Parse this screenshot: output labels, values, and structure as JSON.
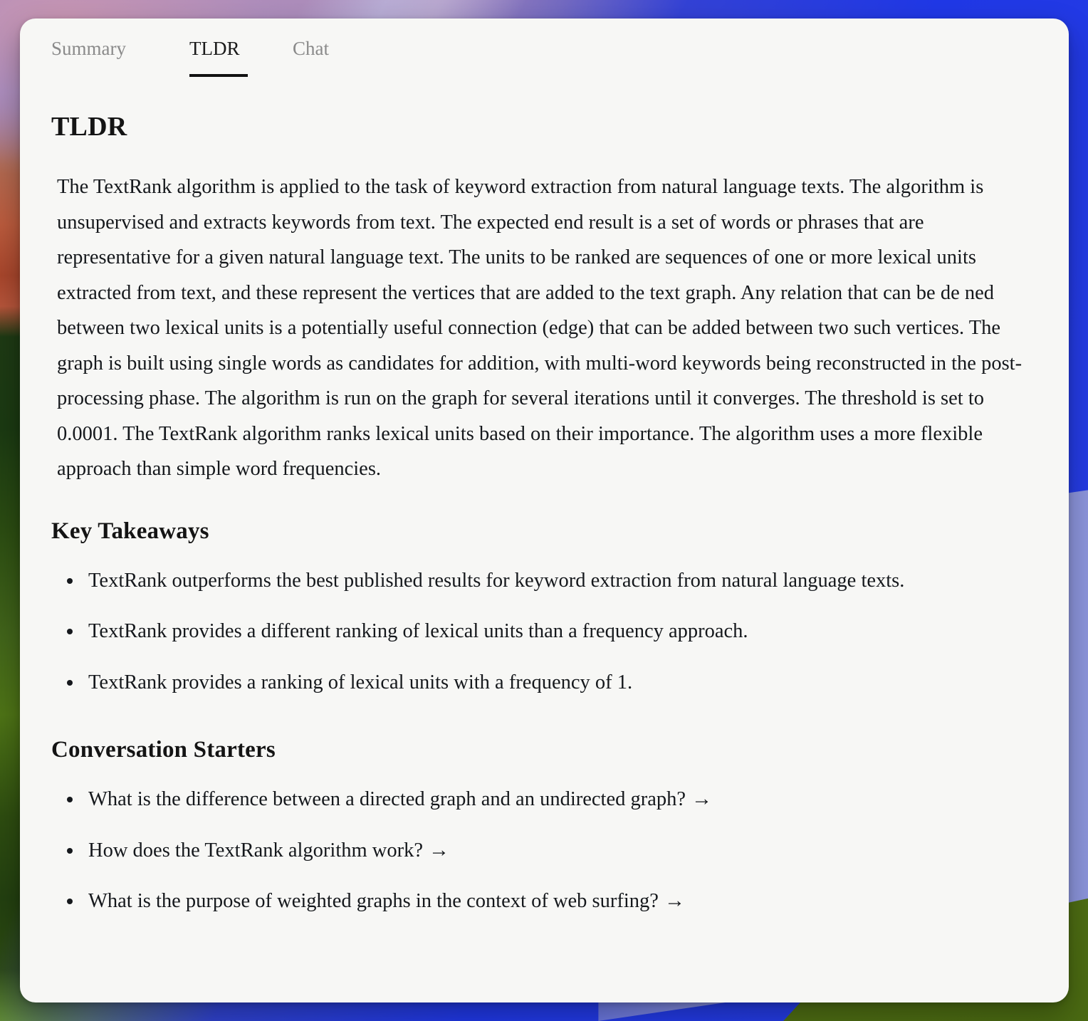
{
  "tabs": [
    {
      "label": "Summary",
      "active": false,
      "name": "tab-summary"
    },
    {
      "label": "TLDR",
      "active": true,
      "name": "tab-tldr"
    },
    {
      "label": "Chat",
      "active": false,
      "name": "tab-chat"
    }
  ],
  "tldr": {
    "heading": "TLDR",
    "body": "The TextRank algorithm is applied to the task of keyword extraction from natural language texts. The algorithm is unsupervised and extracts keywords from text. The expected end result is a set of words or phrases that are representative for a given natural language text. The units to be ranked are sequences of one or more lexical units extracted from text, and these represent the vertices that are added to the text graph. Any relation that can be de ned between two lexical units is a potentially useful connection (edge) that can be added between two such vertices. The graph is built using single words as candidates for addition, with multi-word keywords being reconstructed in the post-processing phase. The algorithm is run on the graph for several iterations until it converges. The threshold is set to 0.0001. The TextRank algorithm ranks lexical units based on their importance. The algorithm uses a more flexible approach than simple word frequencies."
  },
  "key_takeaways": {
    "heading": "Key Takeaways",
    "items": [
      "TextRank outperforms the best published results for keyword extraction from natural language texts.",
      "TextRank provides a different ranking of lexical units than a frequency approach.",
      "TextRank provides a ranking of lexical units with a frequency of 1."
    ]
  },
  "conversation_starters": {
    "heading": "Conversation Starters",
    "arrow_glyph": "→",
    "items": [
      "What is the difference between a directed graph and an undirected graph?",
      "How does the TextRank algorithm work?",
      "What is the purpose of weighted graphs in the context of web surfing?"
    ]
  },
  "colors": {
    "card_background": "#f7f7f5",
    "text_primary": "#15181c",
    "tab_inactive": "#8a8a8a",
    "tab_active": "#1a1a1a",
    "tab_underline": "#111111"
  }
}
